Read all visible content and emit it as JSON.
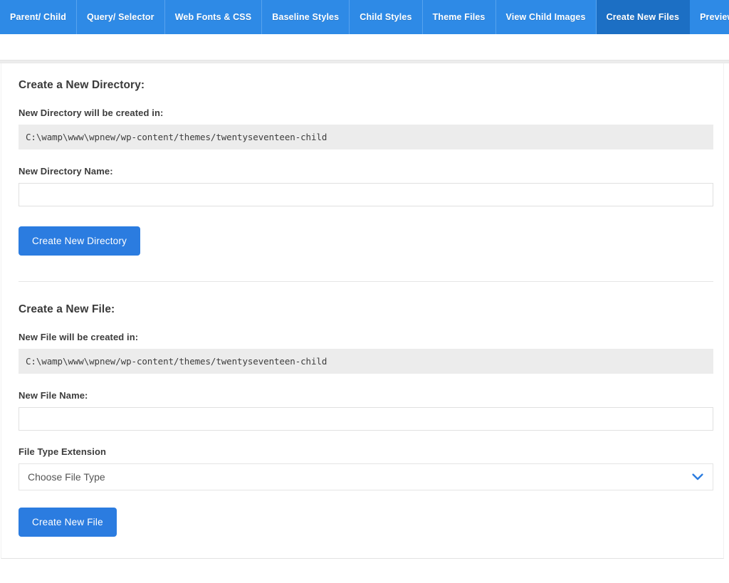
{
  "nav": {
    "tabs": [
      {
        "label": "Parent/ Child",
        "active": false
      },
      {
        "label": "Query/ Selector",
        "active": false
      },
      {
        "label": "Web Fonts & CSS",
        "active": false
      },
      {
        "label": "Baseline Styles",
        "active": false
      },
      {
        "label": "Child Styles",
        "active": false
      },
      {
        "label": "Theme Files",
        "active": false
      },
      {
        "label": "View Child Images",
        "active": false
      },
      {
        "label": "Create New Files",
        "active": true
      },
      {
        "label": "Preview Theme",
        "active": false
      }
    ],
    "active_tab": "Create New Files",
    "colors": {
      "bar": "#2e8ae6",
      "active_tab": "#1c6fc4",
      "separator": "#57a3ee",
      "text": "#ffffff"
    }
  },
  "directory_section": {
    "title": "Create a New Directory:",
    "path_label": "New Directory will be created in:",
    "path_value": "C:\\wamp\\www\\wpnew/wp-content/themes/twentyseventeen-child",
    "name_label": "New Directory Name:",
    "name_value": "",
    "name_placeholder": "",
    "button_label": "Create New Directory"
  },
  "file_section": {
    "title": "Create a New File:",
    "path_label": "New File will be created in:",
    "path_value": "C:\\wamp\\www\\wpnew/wp-content/themes/twentyseventeen-child",
    "name_label": "New File Name:",
    "name_value": "",
    "name_placeholder": "",
    "filetype_label": "File Type Extension",
    "filetype_selected": "Choose File Type",
    "button_label": "Create New File"
  },
  "theme": {
    "accent_blue": "#2b7ce0",
    "path_box_bg": "#ececec",
    "input_border": "#e0e0e0",
    "divider": "#e6e6e6",
    "heading_text": "#3a3a3a"
  }
}
